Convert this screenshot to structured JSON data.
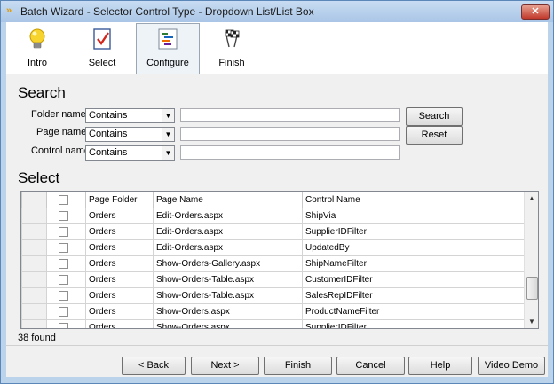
{
  "window": {
    "title": "Batch Wizard - Selector Control Type - Dropdown List/List Box",
    "close_label": "✕"
  },
  "toolbar": {
    "items": [
      {
        "label": "Intro",
        "icon": "lightbulb-icon"
      },
      {
        "label": "Select",
        "icon": "checklist-icon"
      },
      {
        "label": "Configure",
        "icon": "configure-icon"
      },
      {
        "label": "Finish",
        "icon": "checkered-flags-icon"
      }
    ],
    "active": "Configure"
  },
  "search": {
    "title": "Search",
    "folder_label": "Folder name:",
    "page_label": "Page name:",
    "control_label": "Control name:",
    "folder_op": "Contains",
    "page_op": "Contains",
    "control_op": "Contains",
    "folder_value": "",
    "page_value": "",
    "control_value": "",
    "search_button": "Search",
    "reset_button": "Reset"
  },
  "select": {
    "title": "Select",
    "columns": [
      "Page Folder",
      "Page Name",
      "Control Name"
    ],
    "rows": [
      {
        "folder": "Orders",
        "page": "Edit-Orders.aspx",
        "control": "ShipVia"
      },
      {
        "folder": "Orders",
        "page": "Edit-Orders.aspx",
        "control": "SupplierIDFilter"
      },
      {
        "folder": "Orders",
        "page": "Edit-Orders.aspx",
        "control": "UpdatedBy"
      },
      {
        "folder": "Orders",
        "page": "Show-Orders-Gallery.aspx",
        "control": "ShipNameFilter"
      },
      {
        "folder": "Orders",
        "page": "Show-Orders-Table.aspx",
        "control": "CustomerIDFilter"
      },
      {
        "folder": "Orders",
        "page": "Show-Orders-Table.aspx",
        "control": "SalesRepIDFilter"
      },
      {
        "folder": "Orders",
        "page": "Show-Orders.aspx",
        "control": "ProductNameFilter"
      },
      {
        "folder": "Orders",
        "page": "Show-Orders.aspx",
        "control": "SupplierIDFilter"
      }
    ],
    "found_text": "38 found"
  },
  "footer": {
    "back": "< Back",
    "next": "Next >",
    "finish": "Finish",
    "cancel": "Cancel",
    "help": "Help",
    "video_demo": "Video Demo"
  },
  "colors": {
    "title_bar": "#b9d1ea",
    "close_button": "#c0392b",
    "accent": "#e39a00"
  }
}
